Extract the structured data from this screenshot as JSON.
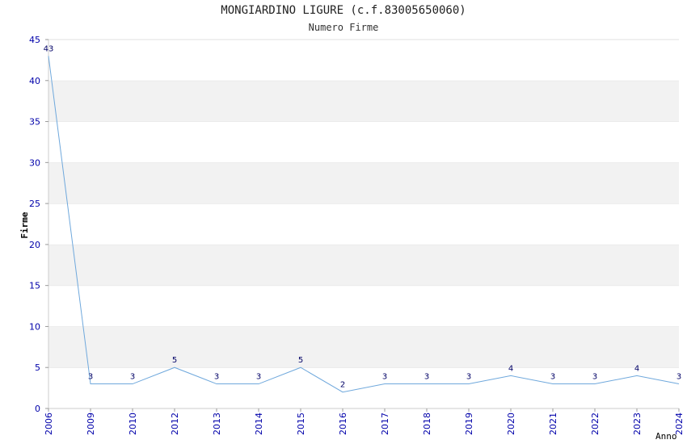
{
  "chart_data": {
    "type": "line",
    "title": "MONGIARDINO LIGURE (c.f.83005650060)",
    "subtitle": "Numero Firme",
    "xlabel": "Anno",
    "ylabel": "Firme",
    "categories": [
      "2006",
      "2009",
      "2010",
      "2012",
      "2013",
      "2014",
      "2015",
      "2016",
      "2017",
      "2018",
      "2019",
      "2020",
      "2021",
      "2022",
      "2023",
      "2024"
    ],
    "values": [
      43,
      3,
      3,
      5,
      3,
      3,
      5,
      2,
      3,
      3,
      3,
      4,
      3,
      3,
      4,
      3
    ],
    "ylim": [
      0,
      45
    ],
    "yticks": [
      0,
      5,
      10,
      15,
      20,
      25,
      30,
      35,
      40,
      45
    ],
    "grid": "horizontal bands",
    "colors": {
      "line": "#6fa8dc",
      "band": "#f2f2f2",
      "tick": "#0000aa"
    }
  }
}
